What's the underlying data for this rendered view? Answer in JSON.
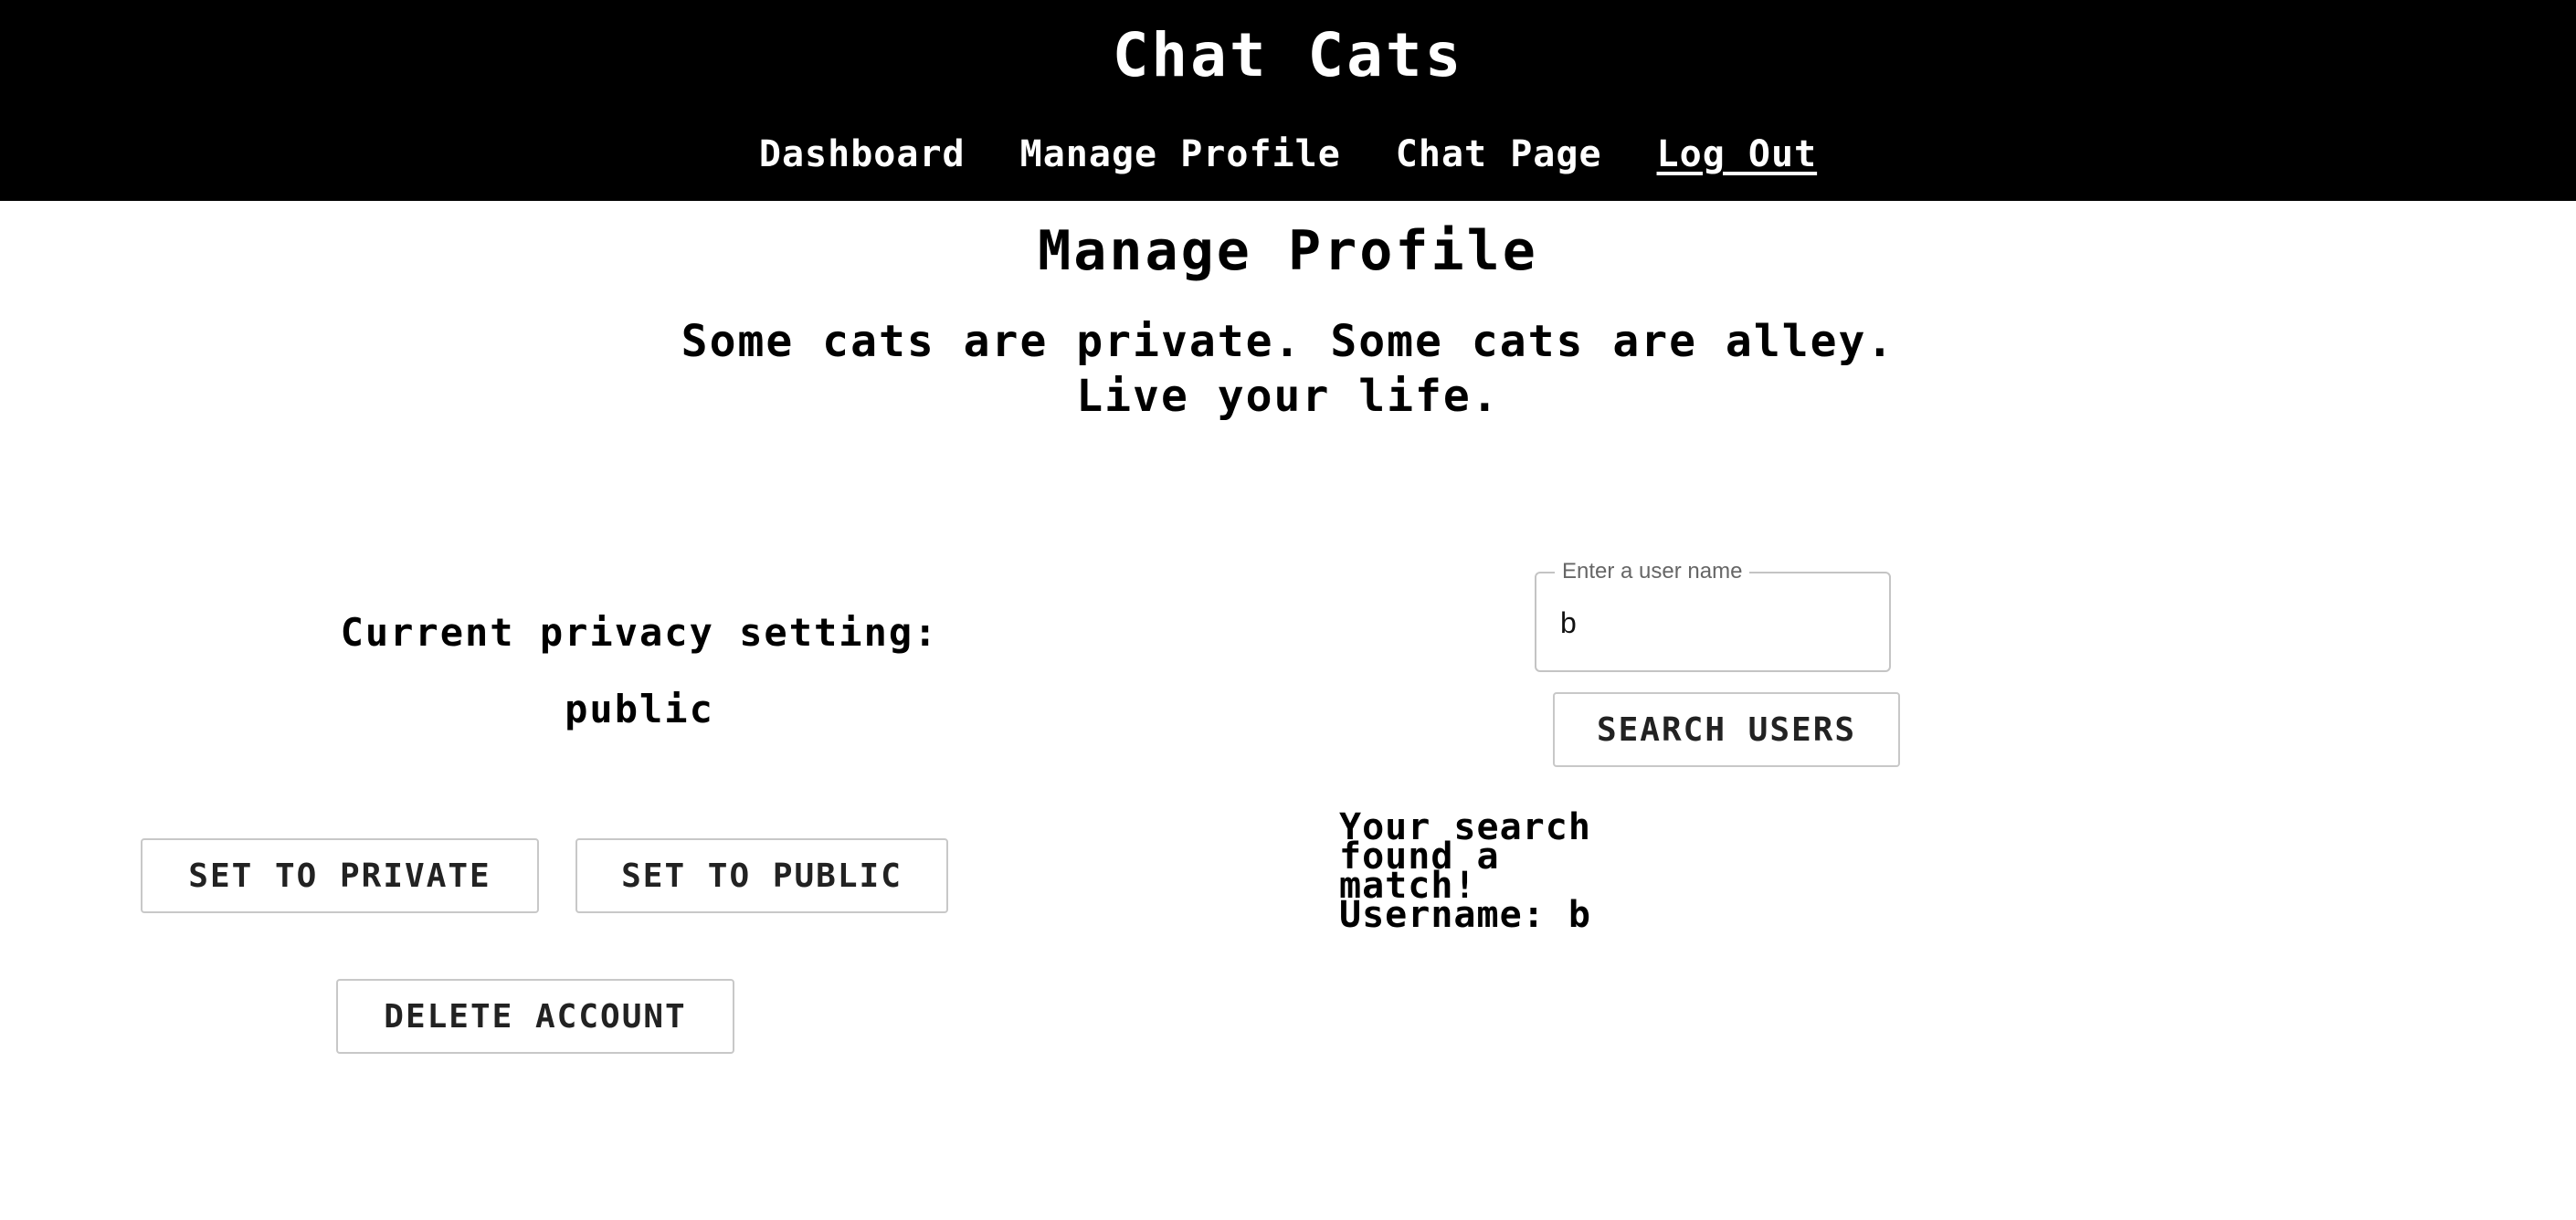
{
  "app": {
    "brand": "Chat Cats"
  },
  "nav": {
    "items": [
      "Dashboard",
      "Manage Profile",
      "Chat Page",
      "Log Out"
    ]
  },
  "main": {
    "title": "Manage Profile",
    "tagline_line1": "Some cats are private. Some cats are alley.",
    "tagline_line2": "Live your life."
  },
  "privacy": {
    "label": "Current privacy setting:",
    "value": "public",
    "set_private_label": "SET TO PRIVATE",
    "set_public_label": "SET TO PUBLIC",
    "delete_label": "DELETE ACCOUNT"
  },
  "search": {
    "legend": "Enter a user name",
    "value": "b",
    "button_label": "SEARCH USERS",
    "result_lines": [
      "Your search",
      "found a",
      "match!",
      "Username: b"
    ]
  }
}
